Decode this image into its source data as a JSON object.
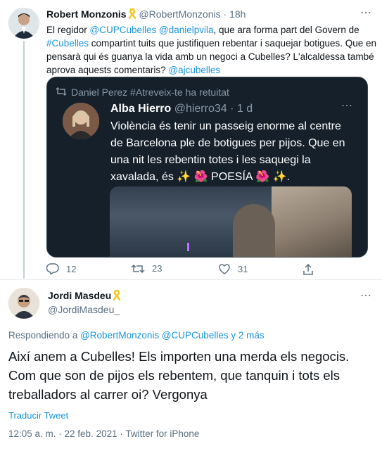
{
  "parent_tweet": {
    "author_name": "Robert Monzonis",
    "author_handle": "@RobertMonzonis",
    "time_ago": "18h",
    "body_parts": {
      "p1": "El regidor ",
      "m1": "@CUPCubelles",
      "sp1": " ",
      "m2": "@danielpvila",
      "p2": ", que ara forma part del Govern de ",
      "m3": "#Cubelles",
      "p3": " compartint tuits que justifiquen rebentar i saquejar botigues. Que en pensarà qui és guanya la vida amb un negoci a Cubelles? L'alcaldessa també aprova aquests comentaris? ",
      "m4": "@ajcubelles"
    },
    "quoted": {
      "retweeted_by": "Daniel Perez #Atreveix-te ha retuitat",
      "author_name": "Alba Hierro",
      "author_handle": "@hierro34",
      "time_ago": "· 1 d",
      "text": "Violència és tenir un passeig enorme al centre de Barcelona ple de botigues per pijos. Que en una nit les rebentin totes i les saquegi la xavalada, és ✨ 🌺 POESÍA 🌺 ✨."
    },
    "actions": {
      "replies": "12",
      "retweets": "23",
      "likes": "31"
    }
  },
  "main_tweet": {
    "author_name": "Jordi Masdeu",
    "author_handle": "@JordiMasdeu_",
    "replying_prefix": "Respondiendo a ",
    "replying_mentions": "@RobertMonzonis @CUPCubelles",
    "replying_suffix": " y 2 más",
    "body": "Així anem a Cubelles! Els importen una merda els negocis. Com que son de pijos els rebentem, que tanquin i tots els treballadors al carrer oi? Vergonya",
    "translate_label": "Traducir Tweet",
    "timestamp": "12:05 a. m. · 22 feb. 2021 · Twitter for iPhone"
  },
  "icons": {
    "ribbon": "yellow-ribbon-icon",
    "more": "more-dots-icon",
    "reply": "reply-icon",
    "retweet": "retweet-icon",
    "like": "heart-icon",
    "share": "share-icon"
  },
  "colors": {
    "link": "#1b95e0",
    "muted": "#5b7083",
    "quote_bg": "#15202b",
    "ribbon": "#f5c518"
  }
}
